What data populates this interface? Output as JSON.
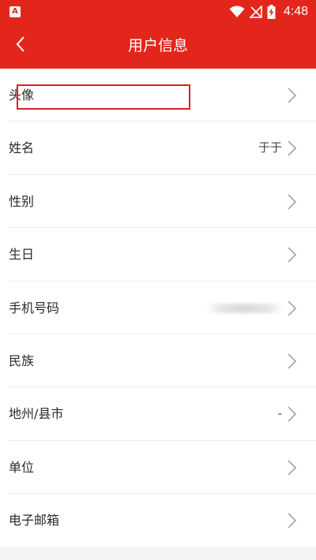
{
  "status_bar": {
    "app_icon_letter": "A",
    "time": "4:48",
    "icons": [
      "wifi-icon",
      "no-signal-icon",
      "battery-charging-icon"
    ]
  },
  "header": {
    "title": "用户信息",
    "back_icon": "chevron-left-icon"
  },
  "colors": {
    "accent": "#e3261c",
    "highlight_box": "#d92028",
    "background": "#f4f4f4",
    "row_background": "#ffffff"
  },
  "rows": [
    {
      "label": "头像",
      "value": ""
    },
    {
      "label": "姓名",
      "value": "于于"
    },
    {
      "label": "性别",
      "value": ""
    },
    {
      "label": "生日",
      "value": ""
    },
    {
      "label": "手机号码",
      "value": ""
    },
    {
      "label": "民族",
      "value": ""
    },
    {
      "label": "地州/县市",
      "value": "-"
    },
    {
      "label": "单位",
      "value": ""
    },
    {
      "label": "电子邮箱",
      "value": ""
    }
  ]
}
